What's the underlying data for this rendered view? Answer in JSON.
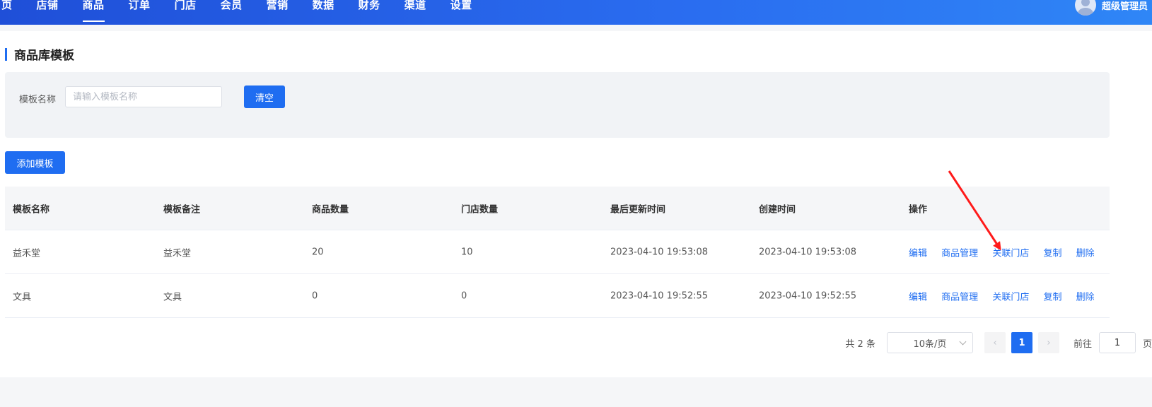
{
  "nav": {
    "items": [
      "页",
      "店铺",
      "商品",
      "订单",
      "门店",
      "会员",
      "营销",
      "数据",
      "财务",
      "渠道",
      "设置"
    ],
    "active_index": 2,
    "user_name": "超级管理员"
  },
  "page": {
    "title": "商品库模板"
  },
  "filter": {
    "label": "模板名称",
    "placeholder": "请输入模板名称",
    "clear_label": "清空"
  },
  "toolbar": {
    "add_label": "添加模板"
  },
  "table": {
    "headers": [
      "模板名称",
      "模板备注",
      "商品数量",
      "门店数量",
      "最后更新时间",
      "创建时间",
      "操作"
    ],
    "rows": [
      {
        "name": "益禾堂",
        "note": "益禾堂",
        "goods": "20",
        "stores": "10",
        "updated": "2023-04-10 19:53:08",
        "created": "2023-04-10 19:53:08"
      },
      {
        "name": "文具",
        "note": "文具",
        "goods": "0",
        "stores": "0",
        "updated": "2023-04-10 19:52:55",
        "created": "2023-04-10 19:52:55"
      }
    ],
    "actions": [
      "编辑",
      "商品管理",
      "关联门店",
      "复制",
      "删除"
    ]
  },
  "pagination": {
    "total_text": "共 2 条",
    "page_size": "10条/页",
    "prev": "‹",
    "current": "1",
    "next": "›",
    "goto_prefix": "前往",
    "goto_value": "1",
    "goto_suffix": "页"
  },
  "colors": {
    "primary": "#1f6df1",
    "annotation": "#ff1a1a"
  }
}
